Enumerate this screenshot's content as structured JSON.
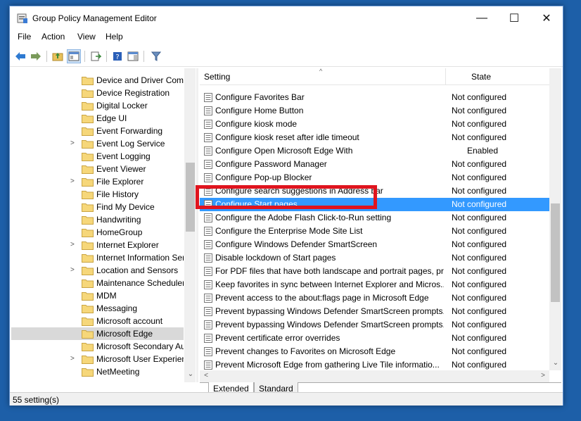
{
  "window": {
    "title": "Group Policy Management Editor",
    "minimize_glyph": "—",
    "maximize_glyph": "☐",
    "close_glyph": "✕"
  },
  "menu": {
    "file": "File",
    "action": "Action",
    "view": "View",
    "help": "Help"
  },
  "toolbar": {
    "icons": [
      "back-arrow-icon",
      "forward-arrow-icon",
      "up-folder-icon",
      "show-hide-tree-icon",
      "export-list-icon",
      "help-icon",
      "properties-view-icon",
      "filter-icon"
    ]
  },
  "tree": {
    "items": [
      {
        "label": "Device and Driver Compatibility",
        "arrow": ""
      },
      {
        "label": "Device Registration",
        "arrow": ""
      },
      {
        "label": "Digital Locker",
        "arrow": ""
      },
      {
        "label": "Edge UI",
        "arrow": ""
      },
      {
        "label": "Event Forwarding",
        "arrow": ""
      },
      {
        "label": "Event Log Service",
        "arrow": ">"
      },
      {
        "label": "Event Logging",
        "arrow": ""
      },
      {
        "label": "Event Viewer",
        "arrow": ""
      },
      {
        "label": "File Explorer",
        "arrow": ">"
      },
      {
        "label": "File History",
        "arrow": ""
      },
      {
        "label": "Find My Device",
        "arrow": ""
      },
      {
        "label": "Handwriting",
        "arrow": ""
      },
      {
        "label": "HomeGroup",
        "arrow": ""
      },
      {
        "label": "Internet Explorer",
        "arrow": ">"
      },
      {
        "label": "Internet Information Services",
        "arrow": ""
      },
      {
        "label": "Location and Sensors",
        "arrow": ">"
      },
      {
        "label": "Maintenance Scheduler",
        "arrow": ""
      },
      {
        "label": "MDM",
        "arrow": ""
      },
      {
        "label": "Messaging",
        "arrow": ""
      },
      {
        "label": "Microsoft account",
        "arrow": ""
      },
      {
        "label": "Microsoft Edge",
        "arrow": "",
        "selected": true
      },
      {
        "label": "Microsoft Secondary Authentication Factor",
        "arrow": ""
      },
      {
        "label": "Microsoft User Experience Virtualization",
        "arrow": ">"
      },
      {
        "label": "NetMeeting",
        "arrow": ""
      }
    ]
  },
  "list": {
    "columns": {
      "setting": "Setting",
      "state": "State"
    },
    "rows": [
      {
        "name": "Configure Favorites Bar",
        "state": "Not configured"
      },
      {
        "name": "Configure Home Button",
        "state": "Not configured"
      },
      {
        "name": "Configure kiosk mode",
        "state": "Not configured"
      },
      {
        "name": "Configure kiosk reset after idle timeout",
        "state": "Not configured"
      },
      {
        "name": "Configure Open Microsoft Edge With",
        "state": "Enabled"
      },
      {
        "name": "Configure Password Manager",
        "state": "Not configured"
      },
      {
        "name": "Configure Pop-up Blocker",
        "state": "Not configured"
      },
      {
        "name": "Configure search suggestions in Address bar",
        "state": "Not configured"
      },
      {
        "name": "Configure Start pages",
        "state": "Not configured",
        "selected": true
      },
      {
        "name": "Configure the Adobe Flash Click-to-Run setting",
        "state": "Not configured"
      },
      {
        "name": "Configure the Enterprise Mode Site List",
        "state": "Not configured"
      },
      {
        "name": "Configure Windows Defender SmartScreen",
        "state": "Not configured"
      },
      {
        "name": "Disable lockdown of Start pages",
        "state": "Not configured"
      },
      {
        "name": "For PDF files that have both landscape and portrait pages, pr...",
        "state": "Not configured"
      },
      {
        "name": "Keep favorites in sync between Internet Explorer and Micros...",
        "state": "Not configured"
      },
      {
        "name": "Prevent access to the about:flags page in Microsoft Edge",
        "state": "Not configured"
      },
      {
        "name": "Prevent bypassing Windows Defender SmartScreen prompts...",
        "state": "Not configured"
      },
      {
        "name": "Prevent bypassing Windows Defender SmartScreen prompts...",
        "state": "Not configured"
      },
      {
        "name": "Prevent certificate error overrides",
        "state": "Not configured"
      },
      {
        "name": "Prevent changes to Favorites on Microsoft Edge",
        "state": "Not configured"
      },
      {
        "name": "Prevent Microsoft Edge from gathering Live Tile informatio...",
        "state": "Not configured"
      }
    ]
  },
  "tabs": {
    "extended": "Extended",
    "standard": "Standard",
    "active": "standard"
  },
  "status": {
    "text": "55 setting(s)"
  },
  "colors": {
    "selection": "#3399ff",
    "highlight_box": "#e0141e",
    "desktop": "#1d5fa8"
  }
}
